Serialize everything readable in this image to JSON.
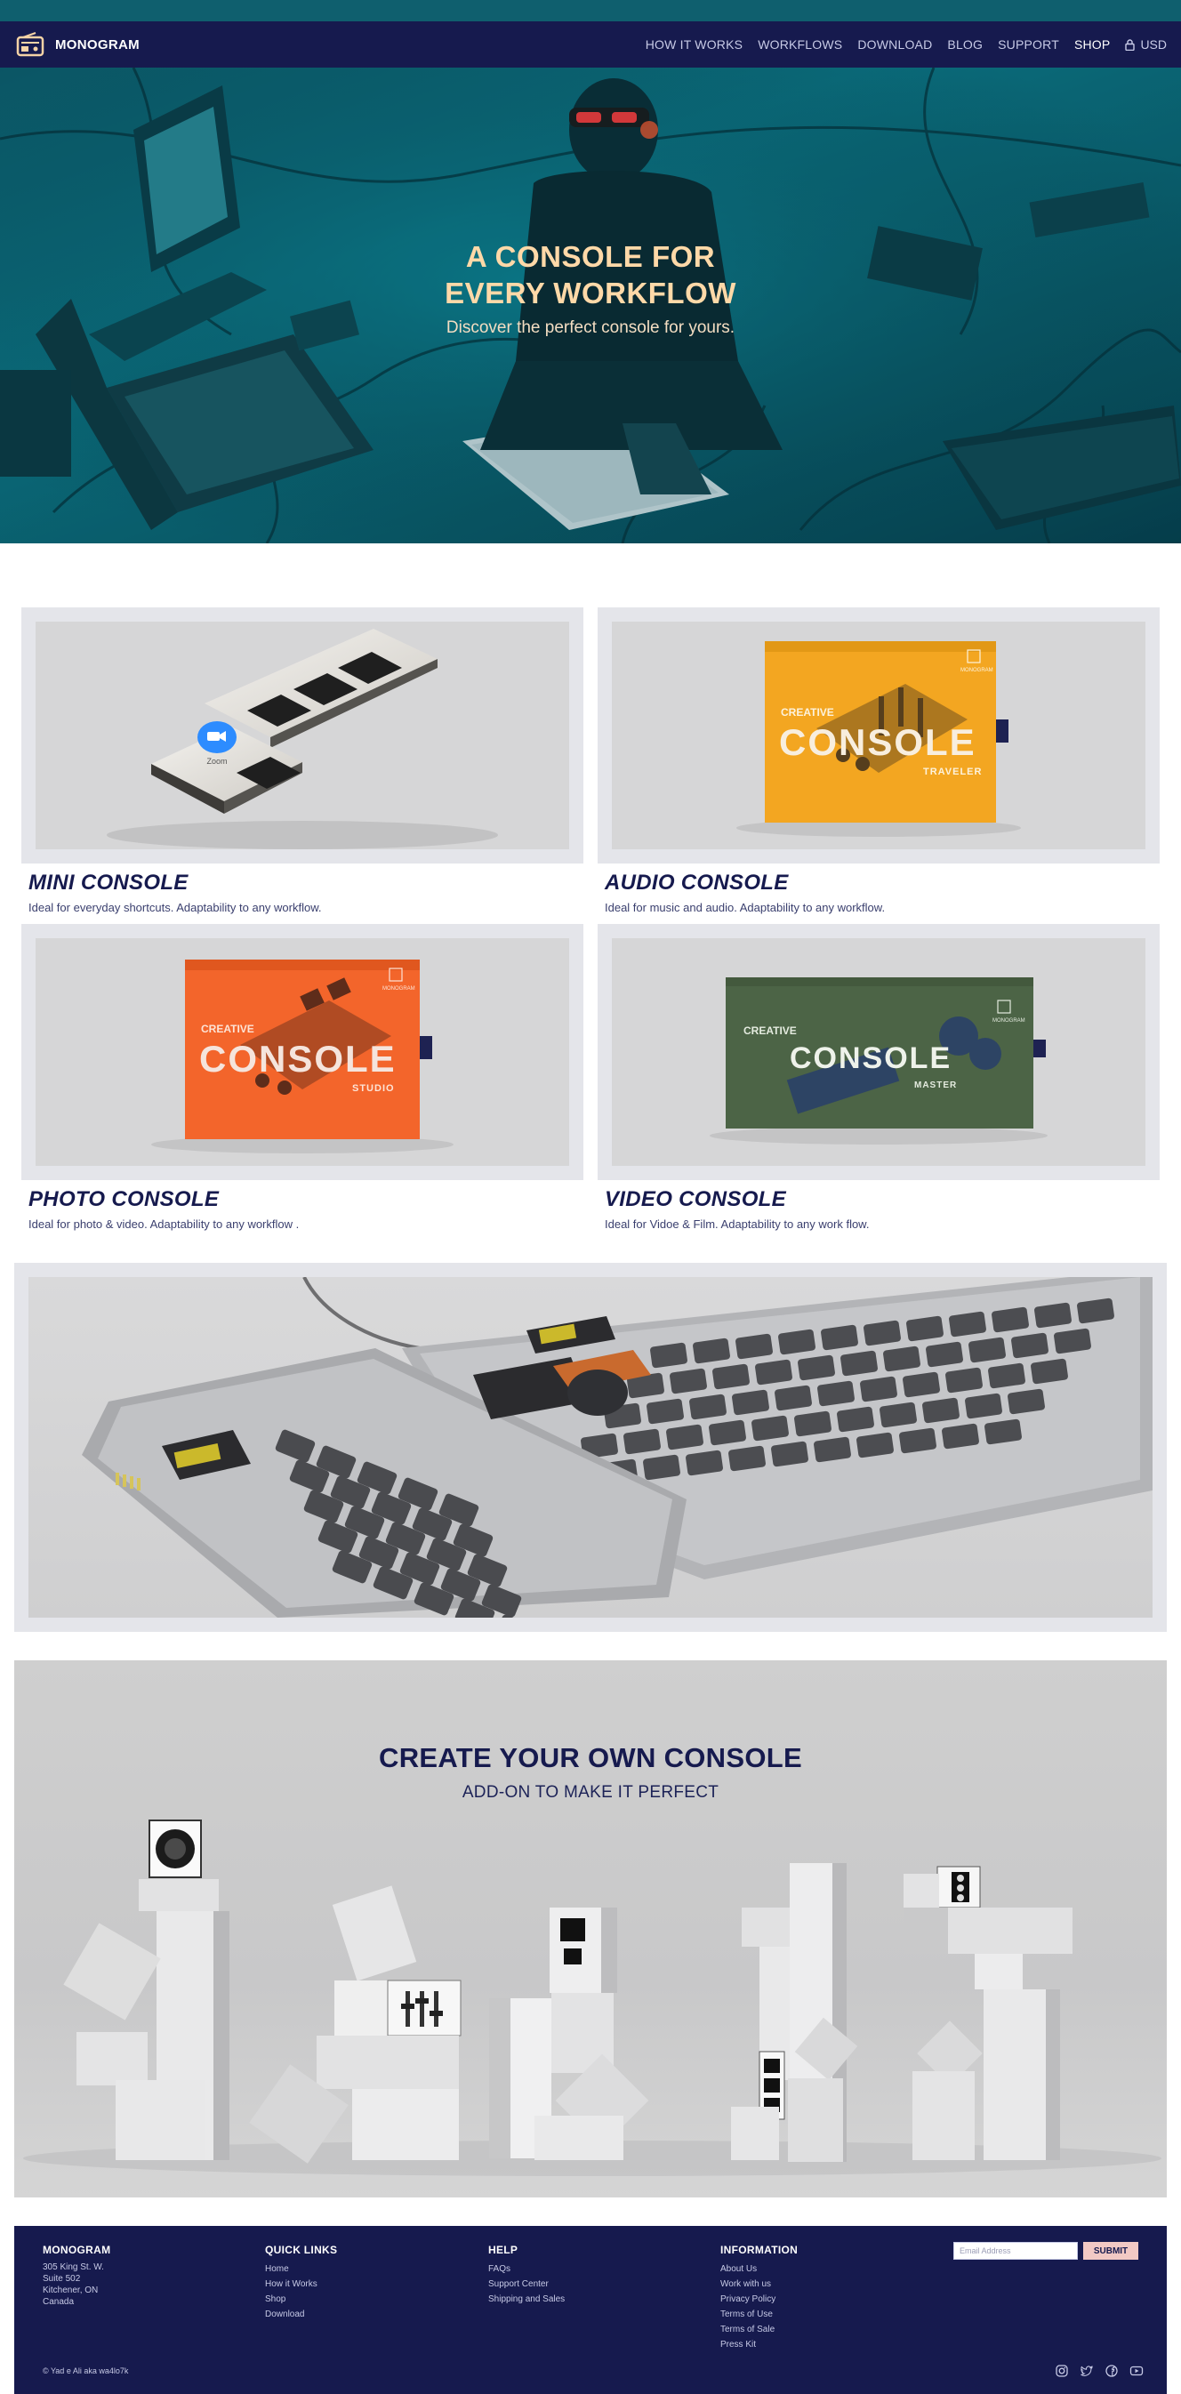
{
  "colors": {
    "navy": "#161a4e",
    "hero_teal": "#0b7a8a",
    "hero_title": "#ffd9a8",
    "accent_pink": "#f2c9c4"
  },
  "nav": {
    "brand": "MONOGRAM",
    "logo_icon": "radio-console-icon",
    "links": [
      "HOW IT WORKS",
      "WORKFLOWS",
      "DOWNLOAD",
      "BLOG",
      "SUPPORT",
      "SHOP"
    ],
    "currency": "USD",
    "currency_icon": "lock-icon"
  },
  "hero": {
    "title_line1": "A CONSOLE FOR",
    "title_line2": "EVERY WORKFLOW",
    "subtitle": "Discover the perfect console for yours."
  },
  "products": [
    {
      "title": "MINI CONSOLE",
      "desc": "Ideal for everyday shortcuts. Adaptability to any workflow.",
      "badge": "Zoom"
    },
    {
      "title": "AUDIO CONSOLE",
      "desc": "Ideal for music and audio. Adaptability to any workflow.",
      "box_pre": "CREATIVE",
      "box_main": "CONSOLE",
      "box_edition": "TRAVELER",
      "box_brand": "MONOGRAM"
    },
    {
      "title": "PHOTO CONSOLE",
      "desc": "Ideal for photo & video. Adaptability to any workflow .",
      "box_pre": "CREATIVE",
      "box_main": "CONSOLE",
      "box_edition": "STUDIO",
      "box_brand": "MONOGRAM"
    },
    {
      "title": "VIDEO CONSOLE",
      "desc": "Ideal for Vidoe & Film. Adaptability to any work flow.",
      "box_pre": "CREATIVE",
      "box_main": "CONSOLE",
      "box_edition": "MASTER",
      "box_brand": "MONOGRAM"
    }
  ],
  "addon": {
    "title": "CREATE YOUR OWN CONSOLE",
    "subtitle": "ADD-ON TO MAKE IT PERFECT"
  },
  "footer": {
    "brand": {
      "title": "MONOGRAM",
      "address": [
        "305 King St. W.",
        "Suite 502",
        "Kitchener, ON",
        "Canada"
      ]
    },
    "quick_links": {
      "title": "QUICK LINKS",
      "items": [
        "Home",
        "How it Works",
        "Shop",
        "Download"
      ]
    },
    "help": {
      "title": "HELP",
      "items": [
        "FAQs",
        "Support Center",
        "Shipping and Sales"
      ]
    },
    "information": {
      "title": "INFORMATION",
      "items": [
        "About Us",
        "Work with us",
        "Privacy Policy",
        "Terms of Use",
        "Terms of Sale",
        "Press Kit"
      ]
    },
    "newsletter": {
      "placeholder": "Email Address",
      "submit": "SUBMIT"
    },
    "copyright": "© Yad e Ali aka wa4lo7k",
    "social_icons": [
      "instagram-icon",
      "twitter-icon",
      "facebook-icon",
      "youtube-icon"
    ]
  }
}
